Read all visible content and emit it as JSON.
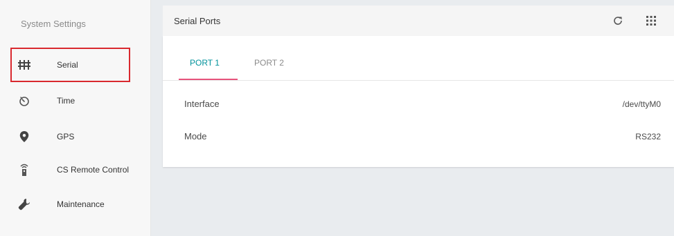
{
  "sidebar": {
    "title": "System Settings",
    "items": [
      {
        "label": "Serial",
        "icon": "serial-icon"
      },
      {
        "label": "Time",
        "icon": "timer-icon"
      },
      {
        "label": "GPS",
        "icon": "location-pin-icon"
      },
      {
        "label": "CS Remote Control",
        "icon": "remote-control-icon"
      },
      {
        "label": "Maintenance",
        "icon": "wrench-icon"
      }
    ]
  },
  "header": {
    "title": "Serial Ports",
    "refresh_icon": "refresh-icon",
    "apps_icon": "grid-apps-icon"
  },
  "tabs": [
    {
      "label": "PORT 1",
      "active": true
    },
    {
      "label": "PORT 2",
      "active": false
    }
  ],
  "fields": [
    {
      "label": "Interface",
      "value": "/dev/ttyM0"
    },
    {
      "label": "Mode",
      "value": "RS232"
    }
  ],
  "colors": {
    "accent": "#00929b",
    "tab_underline": "#e7527b",
    "highlight": "#d9282e"
  }
}
